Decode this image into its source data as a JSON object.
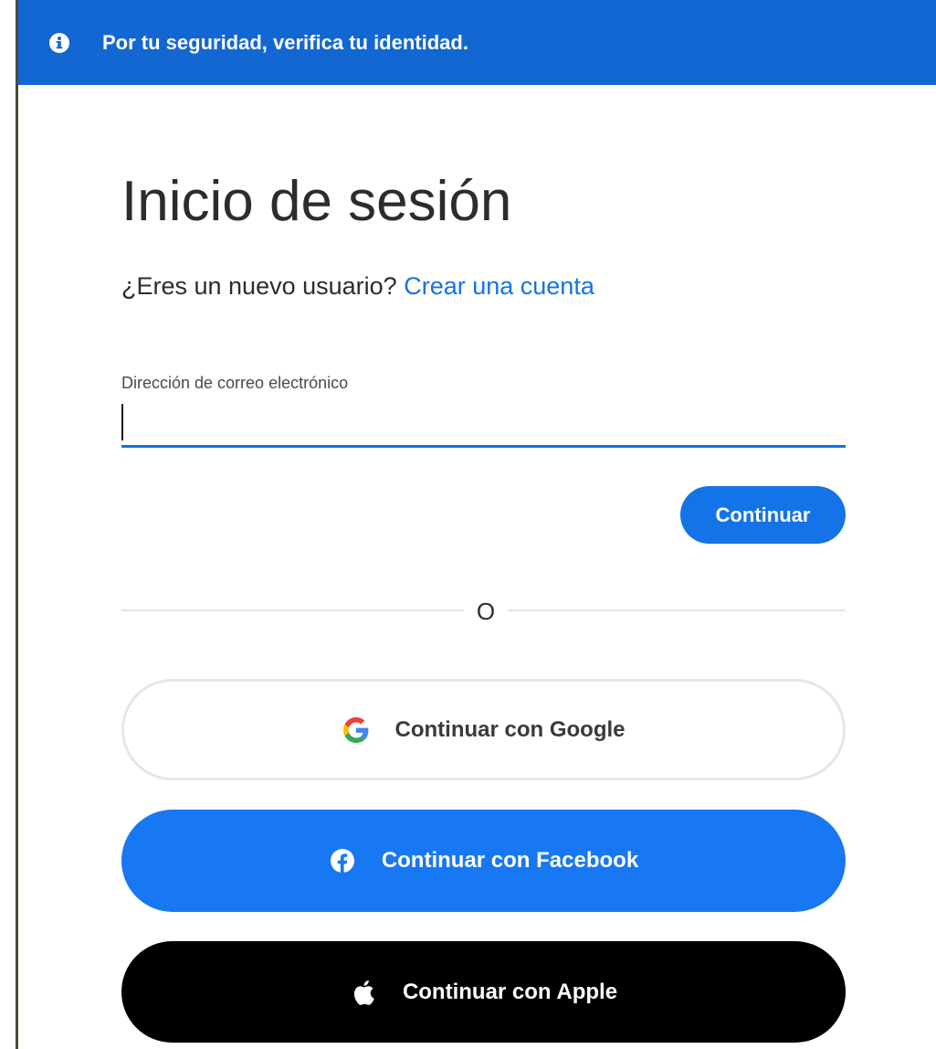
{
  "banner": {
    "icon": "info-circle-icon",
    "text": "Por tu seguridad, verifica tu identidad.",
    "color": "#1267d3"
  },
  "title": "Inicio de sesión",
  "subtitle": {
    "prompt": "¿Eres un nuevo usuario?",
    "link_label": "Crear una cuenta"
  },
  "email": {
    "label": "Dirección de correo electrónico",
    "value": "",
    "placeholder": ""
  },
  "continue_label": "Continuar",
  "divider_label": "O",
  "social": {
    "google": {
      "label": "Continuar con Google",
      "icon": "google-g-icon"
    },
    "facebook": {
      "label": "Continuar con Facebook",
      "icon": "facebook-icon",
      "color": "#1877f2"
    },
    "apple": {
      "label": "Continuar con Apple",
      "icon": "apple-icon",
      "color": "#000000"
    }
  },
  "colors": {
    "accent": "#1473e6",
    "text": "#2c2c2c"
  }
}
